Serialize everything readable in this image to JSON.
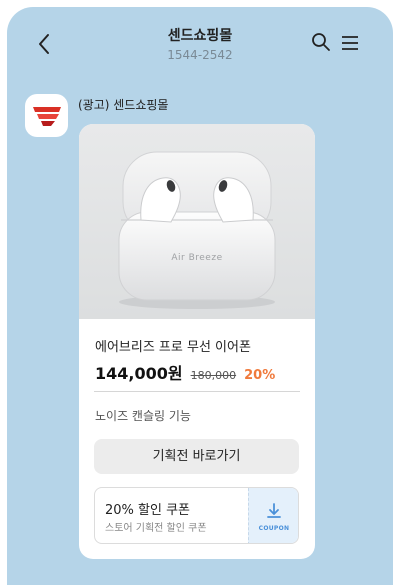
{
  "header": {
    "title": "센드쇼핑몰",
    "subtitle": "1544-2542"
  },
  "message": {
    "sender": "(광고) 센드쇼핑몰"
  },
  "product": {
    "image_brand_text": "Air Breeze",
    "name": "에어브리즈 프로 무선 이어폰",
    "price": "144,000원",
    "original_price": "180,000",
    "discount": "20%",
    "feature": "노이즈 캔슬링 기능"
  },
  "cta": {
    "label": "기획전 바로가기"
  },
  "coupon": {
    "title": "20% 할인 쿠폰",
    "description": "스토어 기획전 할인 쿠폰",
    "badge": "COUPON"
  },
  "colors": {
    "background": "#b5d4e8",
    "discount": "#f07a3c",
    "coupon_accent": "#4a90d9"
  },
  "icons": [
    "back-icon",
    "search-icon",
    "menu-icon",
    "brand-logo-icon",
    "download-icon"
  ]
}
